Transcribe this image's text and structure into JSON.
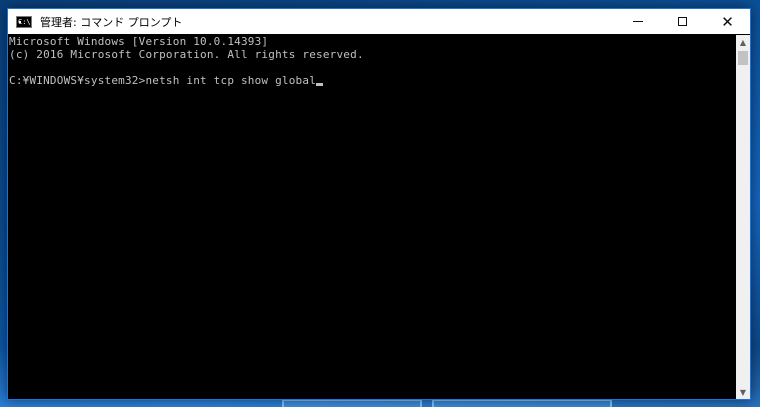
{
  "window": {
    "title": "管理者: コマンド プロンプト",
    "icon_text": "C:\\"
  },
  "controls": {
    "close_glyph": "✕"
  },
  "console": {
    "lines": [
      "Microsoft Windows [Version 10.0.14393]",
      "(c) 2016 Microsoft Corporation. All rights reserved.",
      "",
      "C:¥WINDOWS¥system32>netsh int tcp show global"
    ]
  },
  "scrollbar": {
    "up_glyph": "▲",
    "down_glyph": "▼"
  },
  "colors": {
    "console_bg": "#000000",
    "console_text": "#c0c0c0",
    "titlebar_bg": "#ffffff",
    "window_border": "#1a73d9"
  }
}
